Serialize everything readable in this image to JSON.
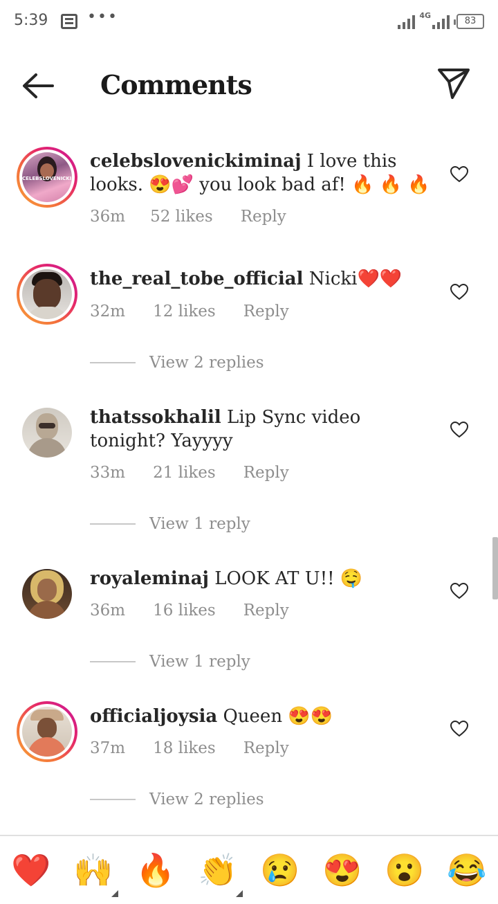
{
  "status": {
    "time": "5:39",
    "network": "4G",
    "battery": "83"
  },
  "header": {
    "title": "Comments"
  },
  "comments": [
    {
      "username": "celebslovenickiminaj",
      "text": " I love this looks. 😍💕 you look bad af! 🔥 🔥 🔥",
      "time": "36m",
      "likes": "52 likes",
      "reply": "Reply",
      "avatar_text": "CELEBSLOVENICKIMINAJ",
      "avatar_icon": "profile-photo-pink"
    },
    {
      "username": "the_real_tobe_official",
      "text": " Nicki❤️❤️",
      "time": "32m",
      "likes": "12 likes",
      "reply": "Reply",
      "view_replies": "View 2 replies",
      "avatar_icon": "profile-photo-man"
    },
    {
      "username": "thatssokhalil",
      "text": " Lip Sync video tonight? Yayyyy",
      "time": "33m",
      "likes": "21 likes",
      "reply": "Reply",
      "view_replies": "View 1 reply",
      "avatar_icon": "profile-photo-masked"
    },
    {
      "username": "royaleminaj",
      "text": " LOOK AT U!! 🤤",
      "time": "36m",
      "likes": "16 likes",
      "reply": "Reply",
      "view_replies": "View 1 reply",
      "avatar_icon": "profile-photo-blonde"
    },
    {
      "username": "officialjoysia",
      "text": " Queen 😍😍",
      "time": "37m",
      "likes": "18 likes",
      "reply": "Reply",
      "view_replies": "View 2 replies",
      "avatar_icon": "profile-photo-hat"
    }
  ],
  "emoji_bar": [
    "❤️",
    "🙌",
    "🔥",
    "👏",
    "😢",
    "😍",
    "😮",
    "😂"
  ],
  "colors": {
    "text": "#262626",
    "muted": "#8e8e8e",
    "ring_start": "#f9a13a",
    "ring_end": "#c9179b",
    "divider": "#c7c7c7"
  }
}
